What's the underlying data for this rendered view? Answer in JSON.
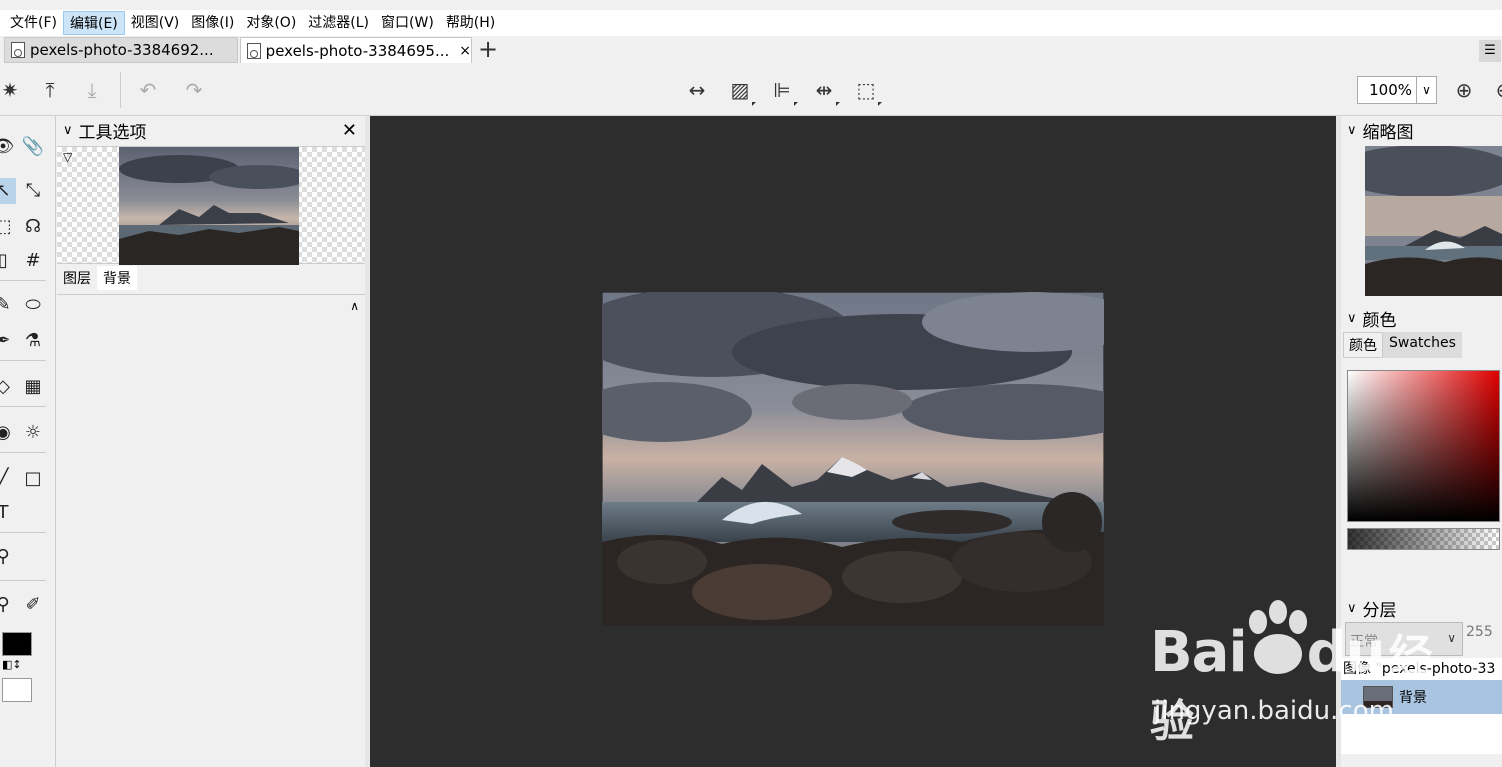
{
  "menu": [
    "文件(F)",
    "编辑(E)",
    "视图(V)",
    "图像(I)",
    "对象(O)",
    "过滤器(L)",
    "窗口(W)",
    "帮助(H)"
  ],
  "tabs": [
    {
      "label": "pexels-photo-3384692..."
    },
    {
      "label": "pexels-photo-3384695...",
      "close": "×"
    }
  ],
  "toolbar": {
    "zoom": "100%"
  },
  "tool_options": {
    "title": "工具选项",
    "tab_layers": "图层",
    "tab_background": "背景"
  },
  "thumbnail": {
    "title": "缩略图"
  },
  "color": {
    "title": "颜色",
    "tab_color": "颜色",
    "tab_swatches": "Swatches"
  },
  "layers": {
    "title": "分层",
    "blend_mode": "正常",
    "opacity": "255",
    "image_row": "图像 \"pexels-photo-33",
    "layer_name": "背景"
  },
  "watermark": {
    "brand": "Bai",
    "brand2": "du",
    "cn": "经验",
    "url": "jingyan.baidu.com"
  },
  "colors": {
    "accent": "#a8c4e0",
    "canvas": "#2d2d2d",
    "fg": "#000000",
    "bg": "#ffffff"
  }
}
